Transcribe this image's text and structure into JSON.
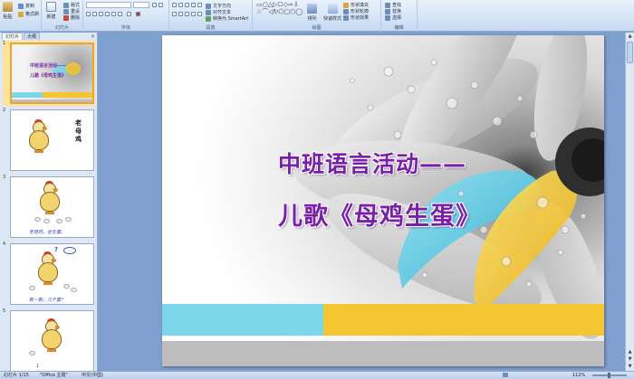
{
  "ribbon": {
    "groups": [
      {
        "id": "clipboard",
        "label": ""
      },
      {
        "id": "slides",
        "label": "幻灯片"
      },
      {
        "id": "font",
        "label": "字体"
      },
      {
        "id": "paragraph",
        "label": "段落"
      },
      {
        "id": "drawing",
        "label": "绘图"
      },
      {
        "id": "editing",
        "label": "编辑"
      }
    ],
    "clipboard": {
      "paste": "粘贴",
      "copy": "复制",
      "format_painter": "格式刷"
    },
    "slides": {
      "new_slide": "新建",
      "new_slide_2": "幻灯片",
      "layout": "版式",
      "reset": "重设",
      "delete": "删除"
    },
    "paragraph": {
      "text_direction": "文字方向",
      "align_text": "对齐文本",
      "smartart": "转换为 SmartArt"
    },
    "drawing": {
      "arrange": "排列",
      "quick_styles": "快速样式",
      "shape_fill": "形状填充",
      "shape_outline": "形状轮廓",
      "shape_effects": "形状效果"
    },
    "editing": {
      "find": "查找",
      "replace": "替换",
      "select": "选择"
    }
  },
  "pane": {
    "tabs": [
      "幻灯片",
      "大纲"
    ],
    "close": "×",
    "slides": [
      {
        "num": "1",
        "line1": "中班语言活动——",
        "line2": "儿歌《母鸡生蛋》"
      },
      {
        "num": "2",
        "vertical": [
          "老",
          "母",
          "鸡"
        ]
      },
      {
        "num": "3",
        "caption": "老母鸡，会生蛋。"
      },
      {
        "num": "4",
        "caption": "数一数，几个蛋？",
        "bubble": "…",
        "question": "?"
      },
      {
        "num": "5",
        "extra": "1"
      }
    ]
  },
  "slide": {
    "title_line1": "中班语言活动——",
    "title_line2": "儿歌《母鸡生蛋》",
    "colors": {
      "title": "#7a1fa8",
      "cyan": "#7ad7ea",
      "yellow": "#f2c531",
      "gray": "#bdbdbd"
    }
  },
  "status": {
    "slide_info": "幻灯片 1/15",
    "theme": "\"Office 主题\"",
    "language": "中文(中国)",
    "zoom": "112%"
  }
}
